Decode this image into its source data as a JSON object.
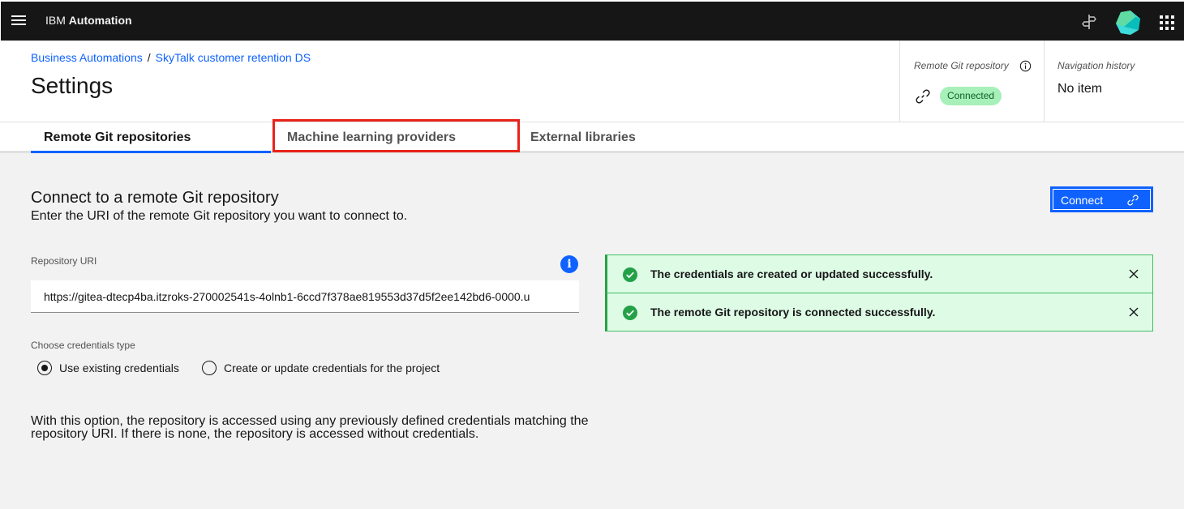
{
  "topbar": {
    "brand_prefix": "IBM",
    "brand_name": "Automation",
    "icons": [
      "menu-icon",
      "signpost-icon",
      "product-logo-icon",
      "app-switcher-icon"
    ]
  },
  "breadcrumb": {
    "items": [
      "Business Automations",
      "SkyTalk customer retention DS"
    ],
    "separator": "/"
  },
  "page": {
    "title": "Settings"
  },
  "git_status": {
    "label": "Remote Git repository",
    "status": "Connected",
    "status_color": "#a7f0ba"
  },
  "nav_history": {
    "label": "Navigation history",
    "value": "No item"
  },
  "tabs": [
    {
      "label": "Remote Git repositories",
      "selected": true
    },
    {
      "label": "Machine learning providers",
      "selected": false,
      "highlighted": true
    },
    {
      "label": "External libraries",
      "selected": false
    }
  ],
  "content": {
    "title": "Connect to a remote Git repository",
    "description": "Enter the URI of the remote Git repository you want to connect to.",
    "connect_button": "Connect",
    "uri_label": "Repository URI",
    "uri_value": "https://gitea-dtecp4ba.itzroks-270002541s-4olnb1-6ccd7f378ae819553d37d5f2ee142bd6-0000.u",
    "credentials_label": "Choose credentials type",
    "credential_options": [
      {
        "label": "Use existing credentials",
        "checked": true
      },
      {
        "label": "Create or update credentials for the project",
        "checked": false
      }
    ],
    "option_note": "With this option, the repository is accessed using any previously defined credentials matching the repository URI. If there is none, the repository is accessed without credentials."
  },
  "notifications": [
    {
      "message": "The credentials are created or updated successfully."
    },
    {
      "message": "The remote Git repository is connected successfully."
    }
  ],
  "colors": {
    "accent": "#0f62fe",
    "success": "#24a148",
    "highlight": "#e8231a",
    "topbar": "#161616"
  }
}
